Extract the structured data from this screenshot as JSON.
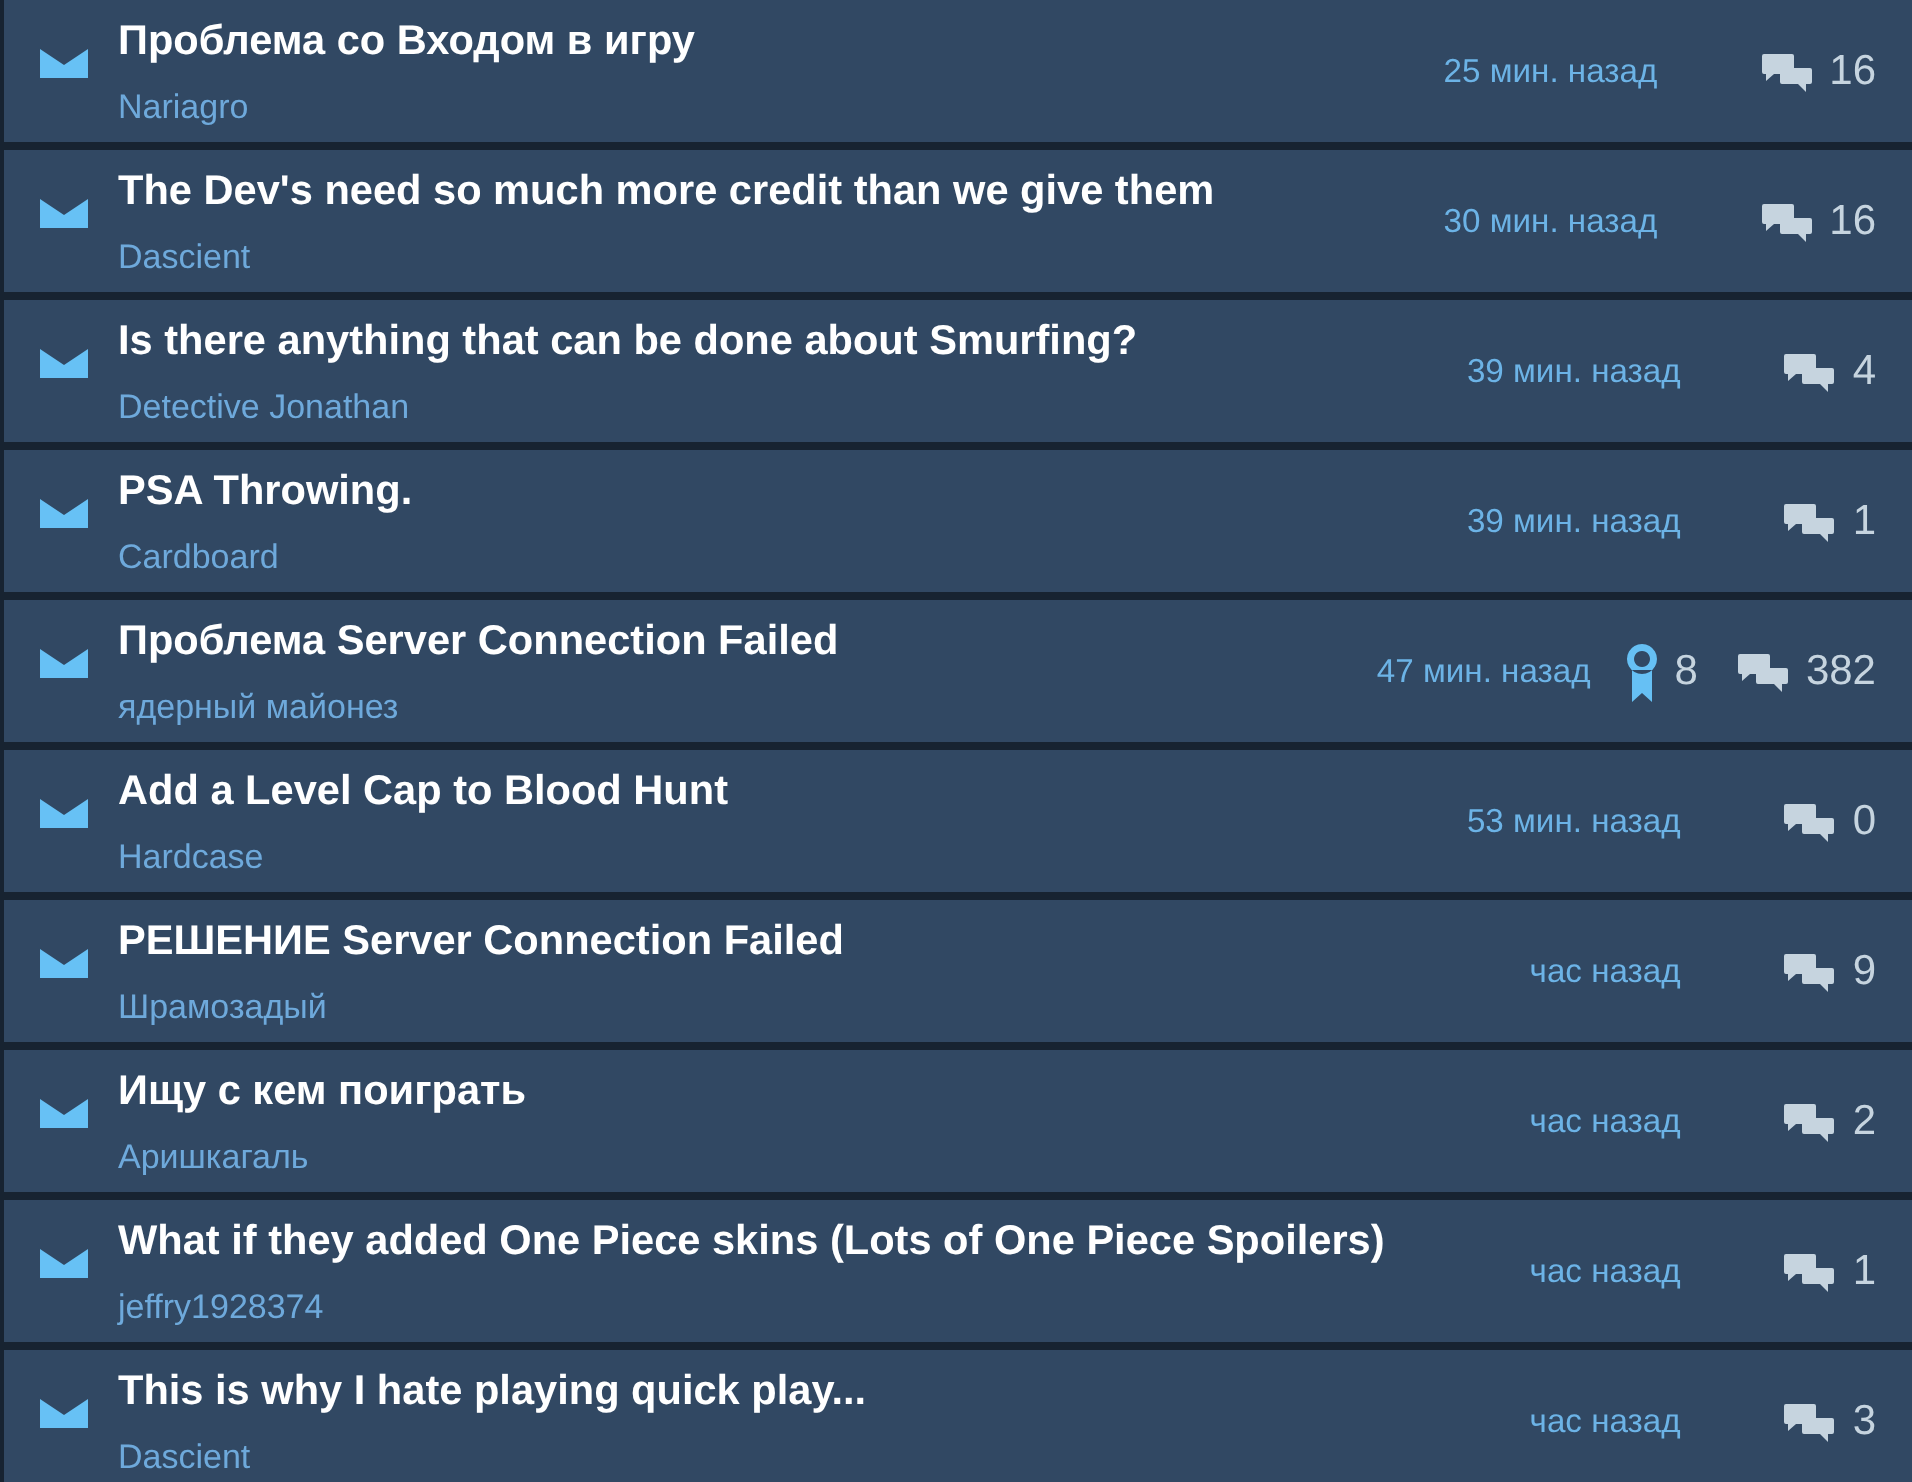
{
  "topics": [
    {
      "title": "Проблема со Входом в игру",
      "author": "Nariagro",
      "time": "25 мин. назад",
      "replies": "16"
    },
    {
      "title": "The Dev's need so much more credit than we give them",
      "author": "Dascient",
      "time": "30 мин. назад",
      "replies": "16"
    },
    {
      "title": "Is there anything that can be done about Smurfing?",
      "author": "Detective Jonathan",
      "time": "39 мин. назад",
      "replies": "4"
    },
    {
      "title": "PSA Throwing.",
      "author": "Cardboard",
      "time": "39 мин. назад",
      "replies": "1"
    },
    {
      "title": "Проблема Server Connection Failed",
      "author": "ядерный майонез",
      "time": "47 мин. назад",
      "awards": "8",
      "replies": "382"
    },
    {
      "title": "Add a Level Cap to Blood Hunt",
      "author": "Hardcase",
      "time": "53 мин. назад",
      "replies": "0"
    },
    {
      "title": "РЕШЕНИЕ Server Connection Failed",
      "author": "Шрамозадый",
      "time": "час назад",
      "replies": "9"
    },
    {
      "title": "Ищу с кем поиграть",
      "author": "Аришкагаль",
      "time": "час назад",
      "replies": "2"
    },
    {
      "title": "What if they added One Piece skins (Lots of One Piece Spoilers)",
      "author": "jeffry1928374",
      "time": "час назад",
      "replies": "1"
    },
    {
      "title": "This is why I hate playing quick play...",
      "author": "Dascient",
      "time": "час назад",
      "replies": "3"
    }
  ]
}
